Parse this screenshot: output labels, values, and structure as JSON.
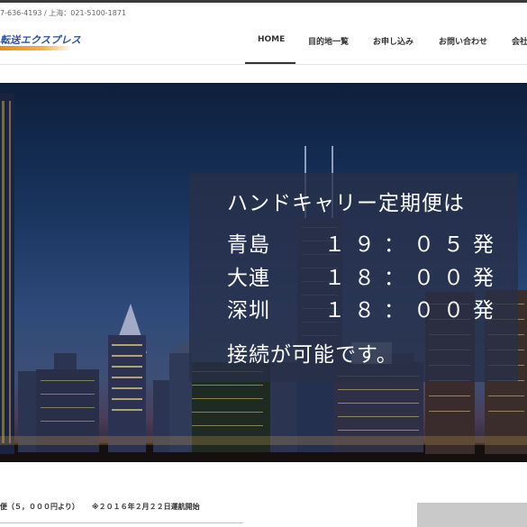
{
  "header": {
    "contact": "7-636-4193 / 上海：021-5100-1871",
    "logo_text": "転送エクスプレス"
  },
  "nav": {
    "items": [
      {
        "label": "HOME"
      },
      {
        "label": "目的地一覧"
      },
      {
        "label": "お申し込み"
      },
      {
        "label": "お問い合わせ"
      },
      {
        "label": "会社"
      }
    ],
    "active": "HOME"
  },
  "hero": {
    "image_alt": "",
    "title": "ハンドキャリー定期便は",
    "schedule": [
      {
        "city": "青島",
        "time": "１９：０５発"
      },
      {
        "city": "大連",
        "time": "１８：００発"
      },
      {
        "city": "深圳",
        "time": "１８：００発"
      }
    ],
    "note": "接続が可能です。"
  },
  "service": {
    "text": "便（５，０００円より）",
    "date": "※２０１６年２月２２日運航開始"
  },
  "colors": {
    "accent_logo": "#2a4fa0",
    "logo_swoosh": "#e88a1a",
    "overlay": "#283048"
  }
}
